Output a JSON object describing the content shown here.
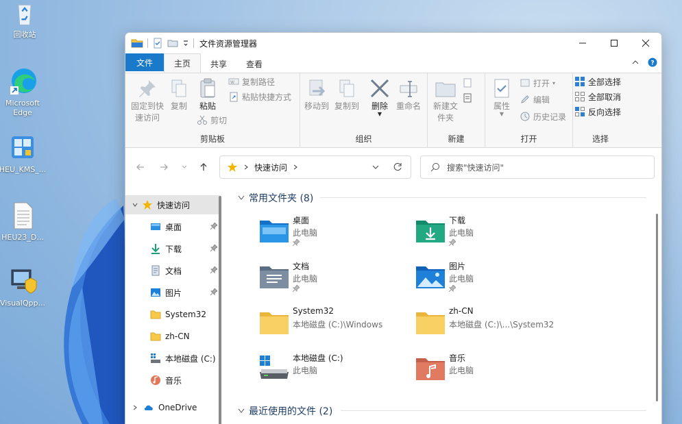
{
  "desktop": {
    "icons": [
      {
        "label": "回收站"
      },
      {
        "label": "Microsoft Edge"
      },
      {
        "label": "HEU_KMS_..."
      },
      {
        "label": "HEU23_D..."
      },
      {
        "label": "VisualQpp..."
      }
    ]
  },
  "window": {
    "title": "文件资源管理器",
    "tabs": {
      "file": "文件",
      "home": "主页",
      "share": "共享",
      "view": "查看"
    },
    "ribbon": {
      "clipboard": {
        "label": "剪贴板",
        "pin_quick": "固定到快速访问",
        "copy": "复制",
        "paste": "粘贴",
        "copy_path": "复制路径",
        "paste_shortcut": "粘贴快捷方式",
        "cut": "剪切"
      },
      "organize": {
        "label": "组织",
        "move_to": "移动到",
        "copy_to": "复制到",
        "delete": "删除",
        "rename": "重命名"
      },
      "new": {
        "label": "新建",
        "new_folder": "新建文件夹"
      },
      "open": {
        "label": "打开",
        "properties": "属性",
        "open": "打开",
        "edit": "编辑",
        "history": "历史记录"
      },
      "select": {
        "label": "选择",
        "select_all": "全部选择",
        "select_none": "全部取消",
        "invert": "反向选择"
      }
    },
    "address": {
      "location": "快速访问",
      "search_placeholder": "搜索\"快速访问\""
    },
    "nav": {
      "items": [
        {
          "label": "快速访问"
        },
        {
          "label": "桌面"
        },
        {
          "label": "下载"
        },
        {
          "label": "文档"
        },
        {
          "label": "图片"
        },
        {
          "label": "System32"
        },
        {
          "label": "zh-CN"
        },
        {
          "label": "本地磁盘 (C:)"
        },
        {
          "label": "音乐"
        },
        {
          "label": "OneDrive"
        }
      ]
    },
    "main": {
      "frequent_header": "常用文件夹 (8)",
      "recent_header": "最近使用的文件 (2)",
      "folders": [
        {
          "name": "桌面",
          "location": "此电脑"
        },
        {
          "name": "下载",
          "location": "此电脑"
        },
        {
          "name": "文档",
          "location": "此电脑"
        },
        {
          "name": "图片",
          "location": "此电脑"
        },
        {
          "name": "System32",
          "location": "本地磁盘 (C:)\\Windows"
        },
        {
          "name": "zh-CN",
          "location": "本地磁盘 (C:)\\...\\System32"
        },
        {
          "name": "本地磁盘 (C:)",
          "location": "此电脑"
        },
        {
          "name": "音乐",
          "location": "此电脑"
        }
      ]
    }
  },
  "colors": {
    "accent": "#1979ca",
    "folder_yellow": "#f7c94a",
    "star": "#f5b400"
  }
}
